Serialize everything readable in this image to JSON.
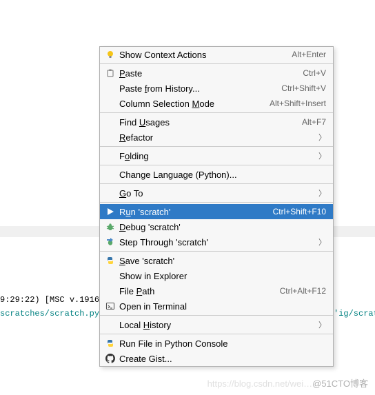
{
  "background": {
    "line1_left": "9:29:22) [MSC v.1916 ",
    "line2_left": "scratches/scratch.py'",
    "line2_right": "'ig/scratches'"
  },
  "watermark": {
    "faint": "https://blog.csdn.net/wei…",
    "bold": "@51CTO博客"
  },
  "menu": {
    "items": [
      {
        "type": "item",
        "icon": "bulb",
        "label_pre": "",
        "label_u": "",
        "label_post": "Show Context Actions",
        "shortcut": "Alt+Enter",
        "arrow": false,
        "selected": false
      },
      {
        "type": "sep"
      },
      {
        "type": "item",
        "icon": "paste",
        "label_pre": "",
        "label_u": "P",
        "label_post": "aste",
        "shortcut": "Ctrl+V",
        "arrow": false,
        "selected": false
      },
      {
        "type": "item",
        "icon": "",
        "label_pre": "Paste ",
        "label_u": "f",
        "label_post": "rom History...",
        "shortcut": "Ctrl+Shift+V",
        "arrow": false,
        "selected": false
      },
      {
        "type": "item",
        "icon": "",
        "label_pre": "Column Selection ",
        "label_u": "M",
        "label_post": "ode",
        "shortcut": "Alt+Shift+Insert",
        "arrow": false,
        "selected": false
      },
      {
        "type": "sep"
      },
      {
        "type": "item",
        "icon": "",
        "label_pre": "Find ",
        "label_u": "U",
        "label_post": "sages",
        "shortcut": "Alt+F7",
        "arrow": false,
        "selected": false
      },
      {
        "type": "item",
        "icon": "",
        "label_pre": "",
        "label_u": "R",
        "label_post": "efactor",
        "shortcut": "",
        "arrow": true,
        "selected": false
      },
      {
        "type": "sep"
      },
      {
        "type": "item",
        "icon": "",
        "label_pre": "F",
        "label_u": "o",
        "label_post": "lding",
        "shortcut": "",
        "arrow": true,
        "selected": false
      },
      {
        "type": "sep"
      },
      {
        "type": "item",
        "icon": "",
        "label_pre": "",
        "label_u": "",
        "label_post": "Change Language (Python)...",
        "shortcut": "",
        "arrow": false,
        "selected": false
      },
      {
        "type": "sep"
      },
      {
        "type": "item",
        "icon": "",
        "label_pre": "",
        "label_u": "G",
        "label_post": "o To",
        "shortcut": "",
        "arrow": true,
        "selected": false
      },
      {
        "type": "sep"
      },
      {
        "type": "item",
        "icon": "play",
        "label_pre": "R",
        "label_u": "u",
        "label_post": "n 'scratch'",
        "shortcut": "Ctrl+Shift+F10",
        "arrow": false,
        "selected": true
      },
      {
        "type": "item",
        "icon": "bug",
        "label_pre": "",
        "label_u": "D",
        "label_post": "ebug 'scratch'",
        "shortcut": "",
        "arrow": false,
        "selected": false
      },
      {
        "type": "item",
        "icon": "step",
        "label_pre": "",
        "label_u": "",
        "label_post": "Step Through 'scratch'",
        "shortcut": "",
        "arrow": true,
        "selected": false
      },
      {
        "type": "sep"
      },
      {
        "type": "item",
        "icon": "python",
        "label_pre": "",
        "label_u": "S",
        "label_post": "ave 'scratch'",
        "shortcut": "",
        "arrow": false,
        "selected": false
      },
      {
        "type": "item",
        "icon": "",
        "label_pre": "",
        "label_u": "",
        "label_post": "Show in Explorer",
        "shortcut": "",
        "arrow": false,
        "selected": false
      },
      {
        "type": "item",
        "icon": "",
        "label_pre": "File ",
        "label_u": "P",
        "label_post": "ath",
        "shortcut": "Ctrl+Alt+F12",
        "arrow": false,
        "selected": false
      },
      {
        "type": "item",
        "icon": "terminal",
        "label_pre": "",
        "label_u": "",
        "label_post": "Open in Terminal",
        "shortcut": "",
        "arrow": false,
        "selected": false
      },
      {
        "type": "sep"
      },
      {
        "type": "item",
        "icon": "",
        "label_pre": "Local ",
        "label_u": "H",
        "label_post": "istory",
        "shortcut": "",
        "arrow": true,
        "selected": false
      },
      {
        "type": "sep"
      },
      {
        "type": "item",
        "icon": "python",
        "label_pre": "",
        "label_u": "",
        "label_post": "Run File in Python Console",
        "shortcut": "",
        "arrow": false,
        "selected": false
      },
      {
        "type": "item",
        "icon": "github",
        "label_pre": "",
        "label_u": "",
        "label_post": "Create Gist...",
        "shortcut": "",
        "arrow": false,
        "selected": false
      }
    ]
  }
}
